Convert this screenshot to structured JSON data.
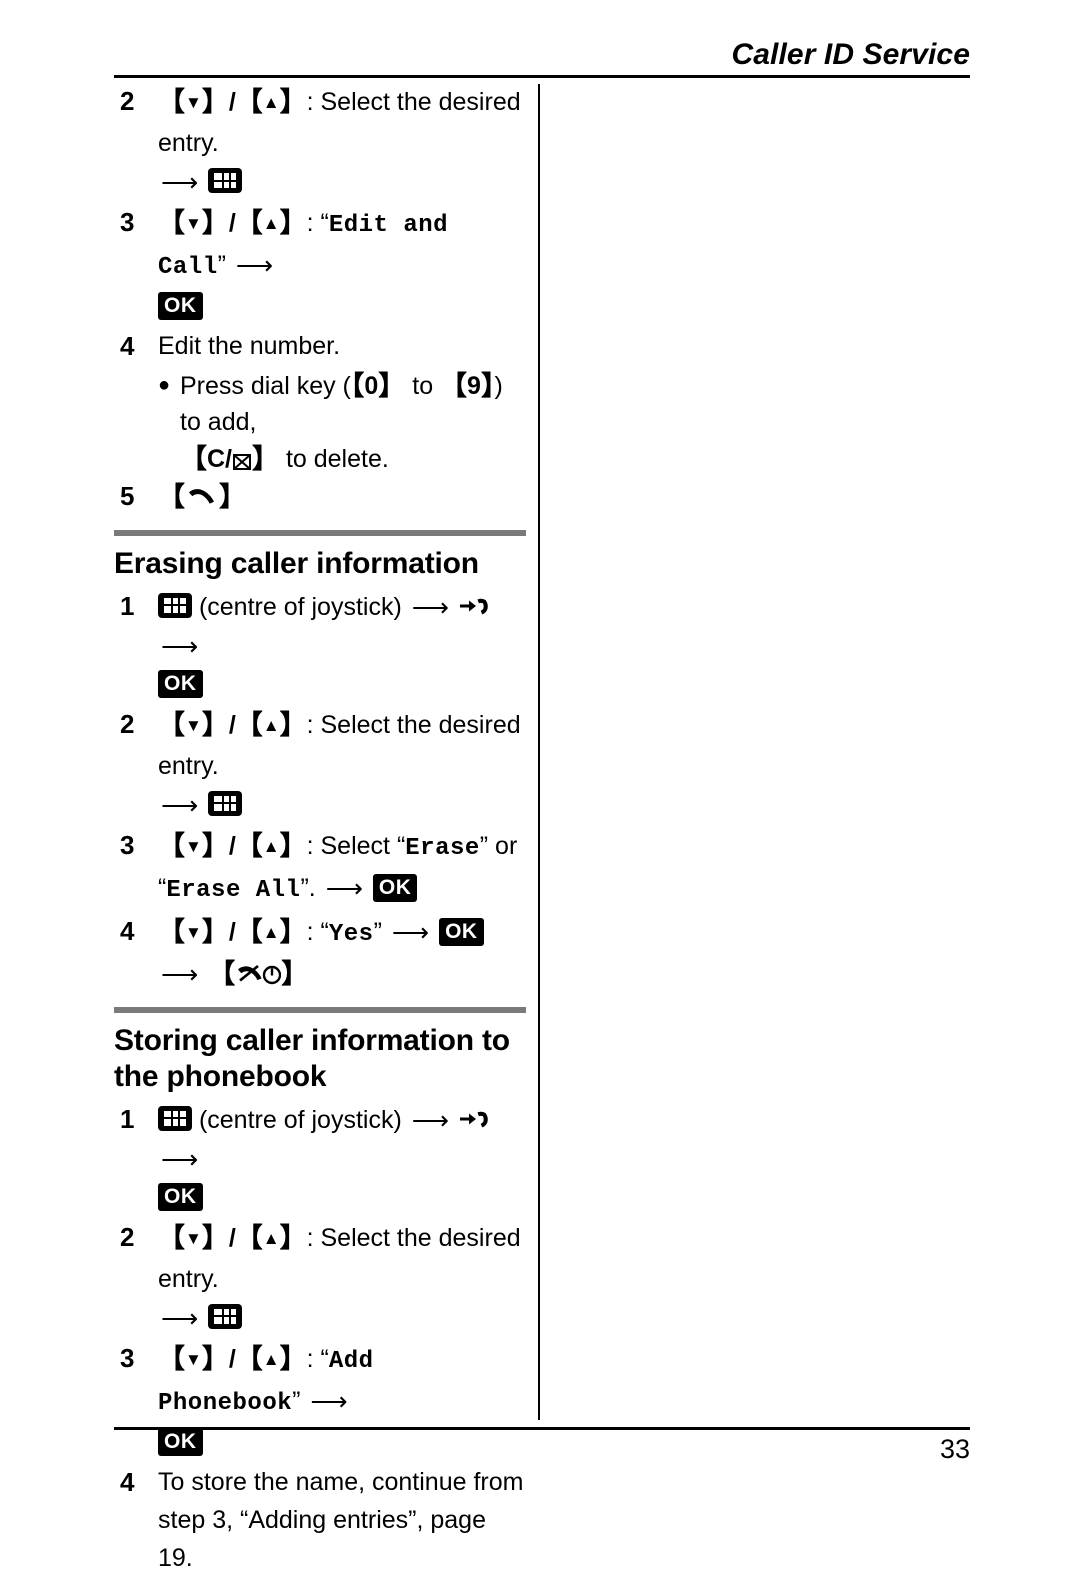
{
  "page": {
    "running_head": "Caller ID Service",
    "folio": "33",
    "accent_rule_color": "#7a7a7a",
    "rule_color": "#000000"
  },
  "icons": {
    "joystick_centre": "joystick-centre-key-icon",
    "caller_list": "incoming-call-list-icon",
    "ok_softkey": "ok-softkey-icon",
    "ok_label": "OK",
    "talk_key": "talk-handset-key-icon",
    "off_key": "power-off-key-icon",
    "end_call_key": "end-call-key-icon",
    "clear_key": "clear-backspace-icon",
    "arrow_right": "arrow-right-icon",
    "down_triangle": "down-triangle-icon",
    "up_triangle": "up-triangle-icon"
  },
  "continued_steps": [
    {
      "num": "2",
      "parts": [
        {
          "t": "key-updown"
        },
        {
          "t": "text",
          "v": ": Select the desired entry."
        },
        {
          "t": "break"
        },
        {
          "t": "arrow"
        },
        {
          "t": "joystick"
        }
      ]
    },
    {
      "num": "3",
      "parts": [
        {
          "t": "key-updown"
        },
        {
          "t": "text",
          "v": ": "
        },
        {
          "t": "quote-mono",
          "v": "Edit and Call"
        },
        {
          "t": "arrow"
        },
        {
          "t": "break"
        },
        {
          "t": "ok"
        }
      ]
    },
    {
      "num": "4",
      "parts": [
        {
          "t": "text",
          "v": "Edit the number."
        }
      ],
      "bullets": [
        {
          "lines": [
            "Press dial key ([0] to [9]) to add,",
            "[C/clear] to delete."
          ],
          "line1_prefix": "Press dial key (",
          "key_a": "0",
          "line1_mid": " to ",
          "key_b": "9",
          "line1_suffix": ") to add,",
          "line2_suffix": " to delete."
        }
      ]
    },
    {
      "num": "5",
      "parts": [
        {
          "t": "talk-key"
        }
      ]
    }
  ],
  "sections": [
    {
      "id": "erasing-caller-information",
      "title": "Erasing caller information",
      "steps": [
        {
          "num": "1",
          "parts": [
            {
              "t": "joystick"
            },
            {
              "t": "text",
              "v": " (centre of joystick) "
            },
            {
              "t": "arrow"
            },
            {
              "t": "caller-list"
            },
            {
              "t": "arrow"
            },
            {
              "t": "break"
            },
            {
              "t": "ok"
            }
          ],
          "joystick_note": "(centre of joystick)"
        },
        {
          "num": "2",
          "parts": [
            {
              "t": "key-updown"
            },
            {
              "t": "text",
              "v": ": Select the desired entry."
            },
            {
              "t": "break"
            },
            {
              "t": "arrow"
            },
            {
              "t": "joystick"
            }
          ]
        },
        {
          "num": "3",
          "parts": [
            {
              "t": "key-updown"
            },
            {
              "t": "text",
              "v": ": Select "
            },
            {
              "t": "quote-mono",
              "v": "Erase"
            },
            {
              "t": "text",
              "v": " or "
            },
            {
              "t": "quote-mono-open",
              "v": "Erase All"
            },
            {
              "t": "text",
              "v": ". "
            },
            {
              "t": "arrow"
            },
            {
              "t": "ok"
            }
          ],
          "menu_option_1": "Erase",
          "menu_option_2": "Erase All"
        },
        {
          "num": "4",
          "parts": [
            {
              "t": "key-updown"
            },
            {
              "t": "text",
              "v": ": "
            },
            {
              "t": "quote-mono",
              "v": "Yes"
            },
            {
              "t": "arrow"
            },
            {
              "t": "ok"
            },
            {
              "t": "arrow"
            },
            {
              "t": "off-key"
            }
          ],
          "menu_option_1": "Yes"
        }
      ]
    },
    {
      "id": "storing-caller-information-to-the-phonebook",
      "title": "Storing caller information to the phonebook",
      "steps": [
        {
          "num": "1",
          "parts": [
            {
              "t": "joystick"
            },
            {
              "t": "text",
              "v": " (centre of joystick) "
            },
            {
              "t": "arrow"
            },
            {
              "t": "caller-list"
            },
            {
              "t": "arrow"
            },
            {
              "t": "break"
            },
            {
              "t": "ok"
            }
          ],
          "joystick_note": "(centre of joystick)"
        },
        {
          "num": "2",
          "parts": [
            {
              "t": "key-updown"
            },
            {
              "t": "text",
              "v": ": Select the desired entry."
            },
            {
              "t": "break"
            },
            {
              "t": "arrow"
            },
            {
              "t": "joystick"
            }
          ]
        },
        {
          "num": "3",
          "parts": [
            {
              "t": "key-updown"
            },
            {
              "t": "text",
              "v": ": "
            },
            {
              "t": "quote-mono",
              "v": "Add Phonebook"
            },
            {
              "t": "arrow"
            },
            {
              "t": "break"
            },
            {
              "t": "ok"
            }
          ],
          "menu_option_1": "Add Phonebook"
        },
        {
          "num": "4",
          "parts": [
            {
              "t": "text",
              "v": "To store the name, continue from step 3, “Adding entries”, page 19."
            }
          ],
          "reference_page": "19",
          "reference_title": "Adding entries"
        }
      ]
    }
  ],
  "strings": {
    "select_entry": ": Select the desired entry.",
    "centre_of_joystick": "(centre of joystick)",
    "edit_the_number": "Edit the number.",
    "press_dial_key_pre": "Press dial key (",
    "to": " to ",
    "to_add": ") to add,",
    "to_delete": " to delete.",
    "select": ": Select ",
    "or": " or ",
    "colon": ": ",
    "period_space": ". ",
    "edit_and_call": "Edit and Call",
    "erase": "Erase",
    "erase_all": "Erase All",
    "yes": "Yes",
    "add_phonebook": "Add Phonebook",
    "store_name_line1": "To store the name, continue from",
    "store_name_line2": "step 3, “Adding entries”, page 19.",
    "key_0": "0",
    "key_9": "9",
    "key_c": "C/",
    "quote_open": "“",
    "quote_close": "”",
    "bracket_open": "【",
    "bracket_close": "】"
  }
}
